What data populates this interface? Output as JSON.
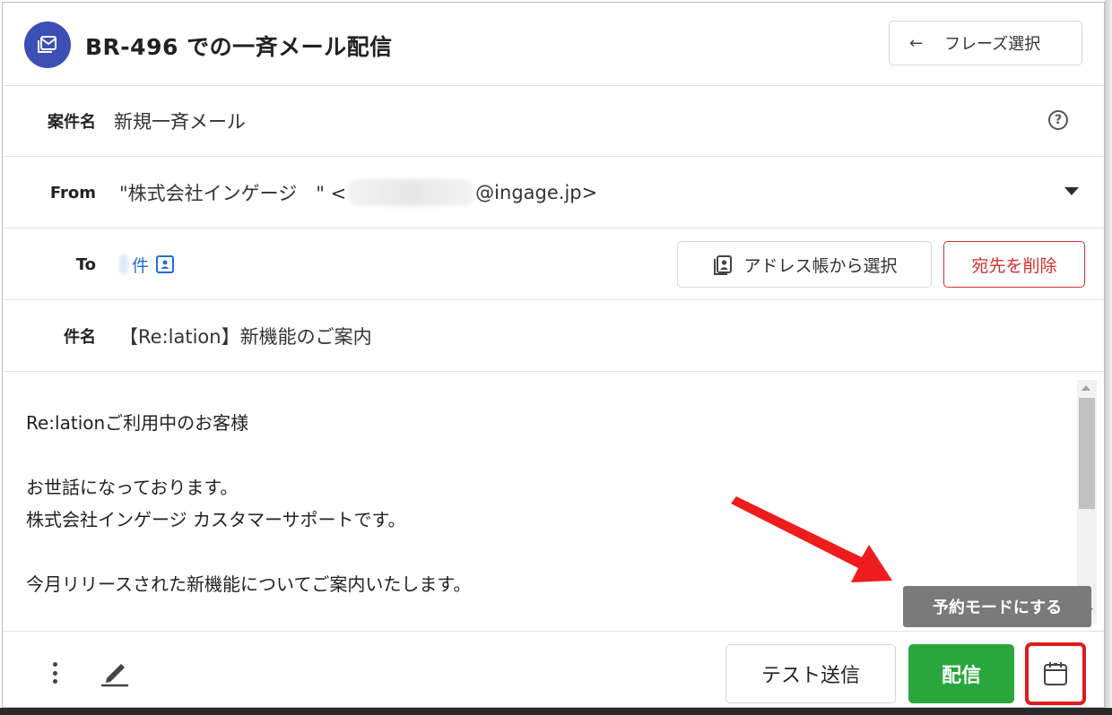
{
  "header": {
    "title": "BR-496 での一斉メール配信",
    "phrase_button_label": "フレーズ選択",
    "phrase_button_icon": "arrow-left-icon"
  },
  "case_row": {
    "label": "案件名",
    "value": "新規一斉メール",
    "help_glyph": "?"
  },
  "from_row": {
    "label": "From",
    "sender_name": "\"株式会社インゲージ　\" <",
    "email_domain": "@ingage.jp>"
  },
  "to_row": {
    "label": "To",
    "count_suffix": "件",
    "address_book_button": "アドレス帳から選択",
    "remove_button": "宛先を削除"
  },
  "subject_row": {
    "label": "件名",
    "value": "【Re:lation】新機能のご案内"
  },
  "body": {
    "lines": [
      "Re:lationご利用中のお客様",
      "",
      "お世話になっております。",
      "株式会社インゲージ カスタマーサポートです。",
      "",
      "今月リリースされた新機能についてご案内いたします。"
    ],
    "tooltip": "予約モードにする"
  },
  "footer": {
    "test_send_button": "テスト送信",
    "send_button": "配信",
    "schedule_icon": "calendar-icon"
  },
  "colors": {
    "brand": "#3b4fb5",
    "send_green": "#2aa73c",
    "danger_red": "#d32f2f",
    "link_blue": "#1f6fd1",
    "highlight_red": "#e01b1b"
  }
}
